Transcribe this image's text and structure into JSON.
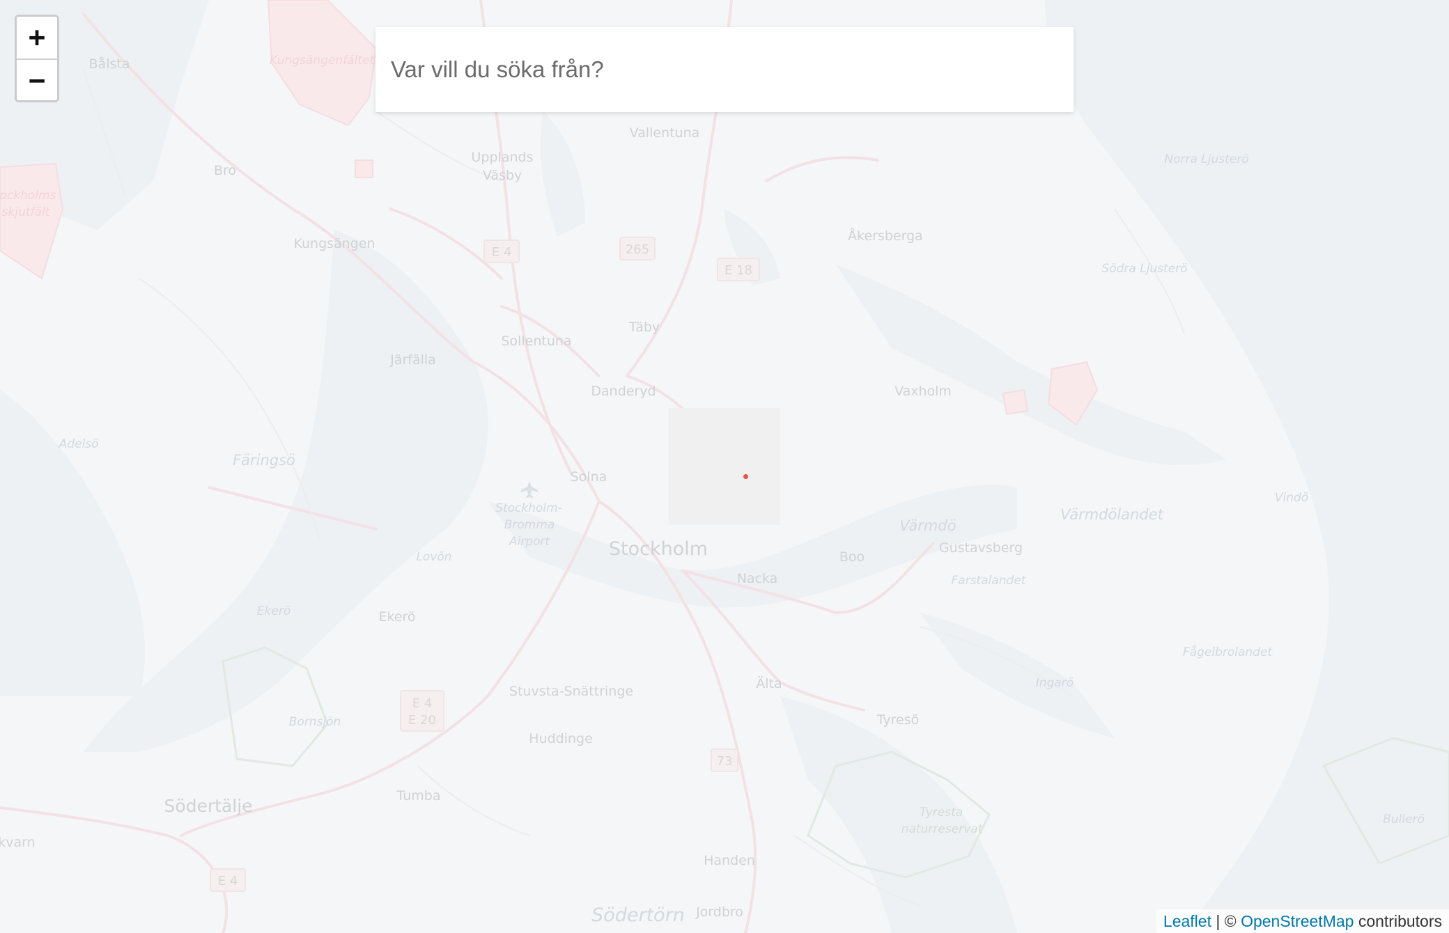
{
  "colors": {
    "land": "#eef0f2",
    "water": "#e2e8ed",
    "road": "#eccfd4",
    "military": "#efc9cd",
    "park": "#cfdccf",
    "link": "#0078a8",
    "loading_dot": "#e8553e"
  },
  "zoom": {
    "in_label": "+",
    "out_label": "−",
    "in_icon": "plus-icon",
    "out_icon": "minus-icon"
  },
  "search": {
    "placeholder": "Var vill du söka från?",
    "value": ""
  },
  "attribution": {
    "leaflet": "Leaflet",
    "separator": " | © ",
    "osm": "OpenStreetMap",
    "suffix": " contributors"
  },
  "labels": {
    "balsta": "Bålsta",
    "kungsangenfaltet": "Kungsängenfältet",
    "vallentuna": "Vallentuna",
    "upplands": "Upplands",
    "vasby": "Väsby",
    "bro": "Bro",
    "stockholms": "ockholms",
    "skjutfalt": "skjutfält",
    "kungsangen": "Kungsängen",
    "norra_ljustero": "Norra Ljusterö",
    "akersberga": "Åkersberga",
    "sodra_ljustero": "Södra Ljusterö",
    "taby": "Täby",
    "sollentuna": "Sollentuna",
    "jarfalla": "Järfälla",
    "danderyd": "Danderyd",
    "vaxholm": "Vaxholm",
    "adelso": "Adelsö",
    "faringso": "Färingsö",
    "solna": "Solna",
    "bromma1": "Stockholm-",
    "bromma2": "Bromma",
    "bromma3": "Airport",
    "stockholm": "Stockholm",
    "varmdo": "Värmdö",
    "varmdolandet": "Värmdölandet",
    "vindo": "Vindö",
    "gustavsberg": "Gustavsberg",
    "lovon": "Lovön",
    "boo": "Boo",
    "nacka": "Nacka",
    "farstalandet": "Farstalandet",
    "ekero_island": "Ekerö",
    "ekero": "Ekerö",
    "fagelbrolandet": "Fågelbrolandet",
    "ingaro": "Ingarö",
    "alta": "Älta",
    "stuvsta": "Stuvsta-Snättringe",
    "bornsjon": "Bornsjön",
    "tyreso": "Tyresö",
    "huddinge": "Huddinge",
    "sodertalje": "Södertälje",
    "tumba": "Tumba",
    "tyresta1": "Tyresta",
    "tyresta2": "naturreservat",
    "bullero": "Bullerö",
    "kvarn": "kvarn",
    "handen": "Handen",
    "sodertorn": "Södertörn",
    "jordbro": "Jordbro"
  },
  "shields": {
    "e4_north": "E 4",
    "r265": "265",
    "e18": "E 18",
    "e4_e20_a": "E 4",
    "e4_e20_b": "E 20",
    "r73": "73",
    "e4_south": "E 4"
  }
}
